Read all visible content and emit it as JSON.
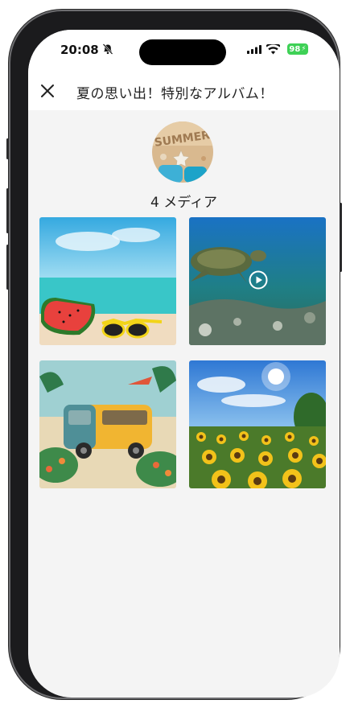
{
  "status": {
    "time": "20:08",
    "battery": "98"
  },
  "header": {
    "title": "夏の思い出！特別なアルバム！"
  },
  "album": {
    "cover_text": "SUMMER",
    "media_count": "4 メディア"
  },
  "media": [
    {
      "subject": "watermelon and sunglasses on beach",
      "type": "photo"
    },
    {
      "subject": "sea turtle underwater",
      "type": "video"
    },
    {
      "subject": "yellow van with flowers",
      "type": "photo"
    },
    {
      "subject": "sunflower field under sky",
      "type": "photo"
    }
  ],
  "colors": {
    "battery": "#3ed156",
    "background": "#f4f4f4"
  }
}
